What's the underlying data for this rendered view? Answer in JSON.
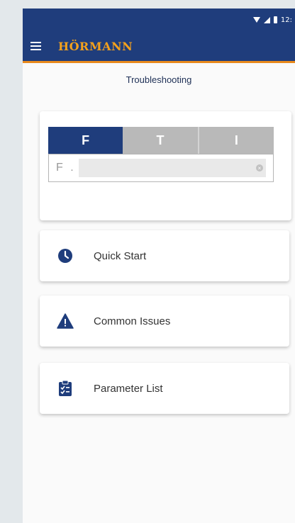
{
  "status_bar": {
    "time": "12:"
  },
  "app_bar": {
    "brand": "HÖRMANN"
  },
  "page": {
    "title": "Troubleshooting"
  },
  "search": {
    "tabs": [
      {
        "label": "F",
        "active": true
      },
      {
        "label": "T",
        "active": false
      },
      {
        "label": "I",
        "active": false
      }
    ],
    "prefix": "F .",
    "value": ""
  },
  "menu": [
    {
      "label": "Quick Start",
      "icon": "clock-icon"
    },
    {
      "label": "Common Issues",
      "icon": "warning-icon"
    },
    {
      "label": "Parameter List",
      "icon": "clipboard-list-icon"
    }
  ],
  "colors": {
    "primary": "#1f3d7c",
    "brand_orange": "#f4a11c",
    "accent_line": "#e8891c"
  }
}
